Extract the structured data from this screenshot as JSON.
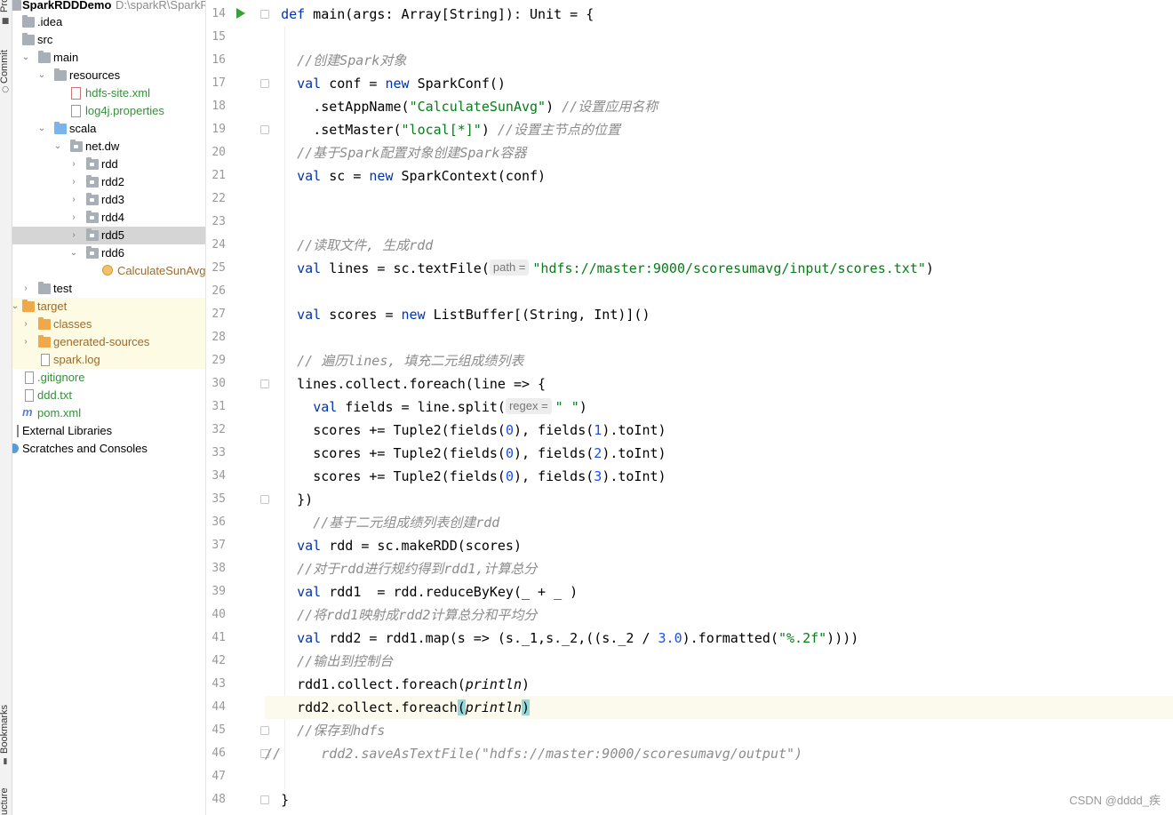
{
  "side_strip": {
    "top_tab": "Pro",
    "commit_tab": "Commit",
    "bookmarks_tab": "Bookmarks",
    "structure_tab": "ucture"
  },
  "project_tree": {
    "root_name": "SparkRDDDemo",
    "root_path": "D:\\sparkR\\SparkR",
    "items": [
      {
        "label": "SparkRDDDemo",
        "icon": "folder-icon"
      },
      {
        "label": ".idea",
        "icon": "folder-icon"
      },
      {
        "label": "src",
        "icon": "folder-icon"
      },
      {
        "label": "main",
        "icon": "folder-icon"
      },
      {
        "label": "resources",
        "icon": "resources-folder-icon"
      },
      {
        "label": "hdfs-site.xml",
        "icon": "xml-file-icon"
      },
      {
        "label": "log4j.properties",
        "icon": "properties-file-icon"
      },
      {
        "label": "scala",
        "icon": "source-folder-icon"
      },
      {
        "label": "net.dw",
        "icon": "package-icon"
      },
      {
        "label": "rdd",
        "icon": "package-icon"
      },
      {
        "label": "rdd2",
        "icon": "package-icon"
      },
      {
        "label": "rdd3",
        "icon": "package-icon"
      },
      {
        "label": "rdd4",
        "icon": "package-icon"
      },
      {
        "label": "rdd5",
        "icon": "package-icon"
      },
      {
        "label": "rdd6",
        "icon": "package-icon"
      },
      {
        "label": "CalculateSunAvg",
        "icon": "scala-object-icon"
      },
      {
        "label": "test",
        "icon": "folder-icon"
      },
      {
        "label": "target",
        "icon": "excluded-folder-icon"
      },
      {
        "label": "classes",
        "icon": "excluded-folder-icon"
      },
      {
        "label": "generated-sources",
        "icon": "excluded-folder-icon"
      },
      {
        "label": "spark.log",
        "icon": "text-file-icon"
      },
      {
        "label": ".gitignore",
        "icon": "gitignore-file-icon"
      },
      {
        "label": "ddd.txt",
        "icon": "text-file-icon"
      },
      {
        "label": "pom.xml",
        "icon": "maven-icon"
      },
      {
        "label": "External Libraries",
        "icon": "libraries-icon"
      },
      {
        "label": "Scratches and Consoles",
        "icon": "scratches-icon"
      }
    ]
  },
  "editor": {
    "line_numbers": [
      "14",
      "15",
      "16",
      "17",
      "18",
      "19",
      "20",
      "21",
      "22",
      "23",
      "24",
      "25",
      "26",
      "27",
      "28",
      "29",
      "30",
      "31",
      "32",
      "33",
      "34",
      "35",
      "36",
      "37",
      "38",
      "39",
      "40",
      "41",
      "42",
      "43",
      "44",
      "45",
      "46",
      "47",
      "48"
    ],
    "hint_path": "path =",
    "hint_regex": "regex =",
    "lines": {
      "l14": {
        "a": "def",
        "b": " main(args: Array[String]): Unit = {"
      },
      "l16": "//创建Spark对象",
      "l17": {
        "a": "val",
        "b": " conf = ",
        "c": "new",
        "d": " SparkConf()"
      },
      "l18": {
        "a": ".setAppName(",
        "b": "\"CalculateSunAvg\"",
        "c": ") ",
        "d": "//设置应用名称"
      },
      "l19": {
        "a": ".setMaster(",
        "b": "\"local[*]\"",
        "c": ") ",
        "d": "//设置主节点的位置"
      },
      "l20": "//基于Spark配置对象创建Spark容器",
      "l21": {
        "a": "val",
        "b": " sc = ",
        "c": "new",
        "d": " SparkContext(conf)"
      },
      "l24": "//读取文件, 生成rdd",
      "l25": {
        "a": "val",
        "b": " lines = sc.textFile(",
        "c": "\"hdfs://master:9000/scoresumavg/input/scores.txt\"",
        "d": ")"
      },
      "l27": {
        "a": "val",
        "b": " scores = ",
        "c": "new",
        "d": " ListBuffer[(String, Int)]()"
      },
      "l29": "// 遍历lines, 填充二元组成绩列表",
      "l30": "lines.collect.foreach(line => {",
      "l31": {
        "a": "val",
        "b": " fields = line.split(",
        "c": "\" \"",
        "d": ")"
      },
      "l32": {
        "a": "scores += Tuple2(fields(",
        "b": "0",
        "c": "), fields(",
        "d": "1",
        "e": ").toInt)"
      },
      "l33": {
        "a": "scores += Tuple2(fields(",
        "b": "0",
        "c": "), fields(",
        "d": "2",
        "e": ").toInt)"
      },
      "l34": {
        "a": "scores += Tuple2(fields(",
        "b": "0",
        "c": "), fields(",
        "d": "3",
        "e": ").toInt)"
      },
      "l35": "})",
      "l36": "//基于二元组成绩列表创建rdd",
      "l37": {
        "a": "val",
        "b": " rdd = sc.makeRDD(scores)"
      },
      "l38": "//对于rdd进行规约得到rdd1,计算总分",
      "l39": {
        "a": "val",
        "b": " rdd1  = rdd.reduceByKey(_ + _ )"
      },
      "l40": "//将rdd1映射成rdd2计算总分和平均分",
      "l41": {
        "a": "val",
        "b": " rdd2 = rdd1.map(s => (s._1,s._2,((s._2 / ",
        "c": "3.0",
        "d": ").formatted(",
        "e": "\"%.2f\"",
        "f": "))))"
      },
      "l42": "//输出到控制台",
      "l43": {
        "a": "rdd1.collect.foreach(",
        "b": "println",
        "c": ")"
      },
      "l44": {
        "a": "rdd2.collect.foreach",
        "b": "(",
        "c": "println",
        "d": ")"
      },
      "l45": "//保存到hdfs",
      "l46": "//     rdd2.saveAsTextFile(\"hdfs://master:9000/scoresumavg/output\")",
      "l48": "}"
    }
  },
  "watermark": "CSDN @dddd_疾"
}
